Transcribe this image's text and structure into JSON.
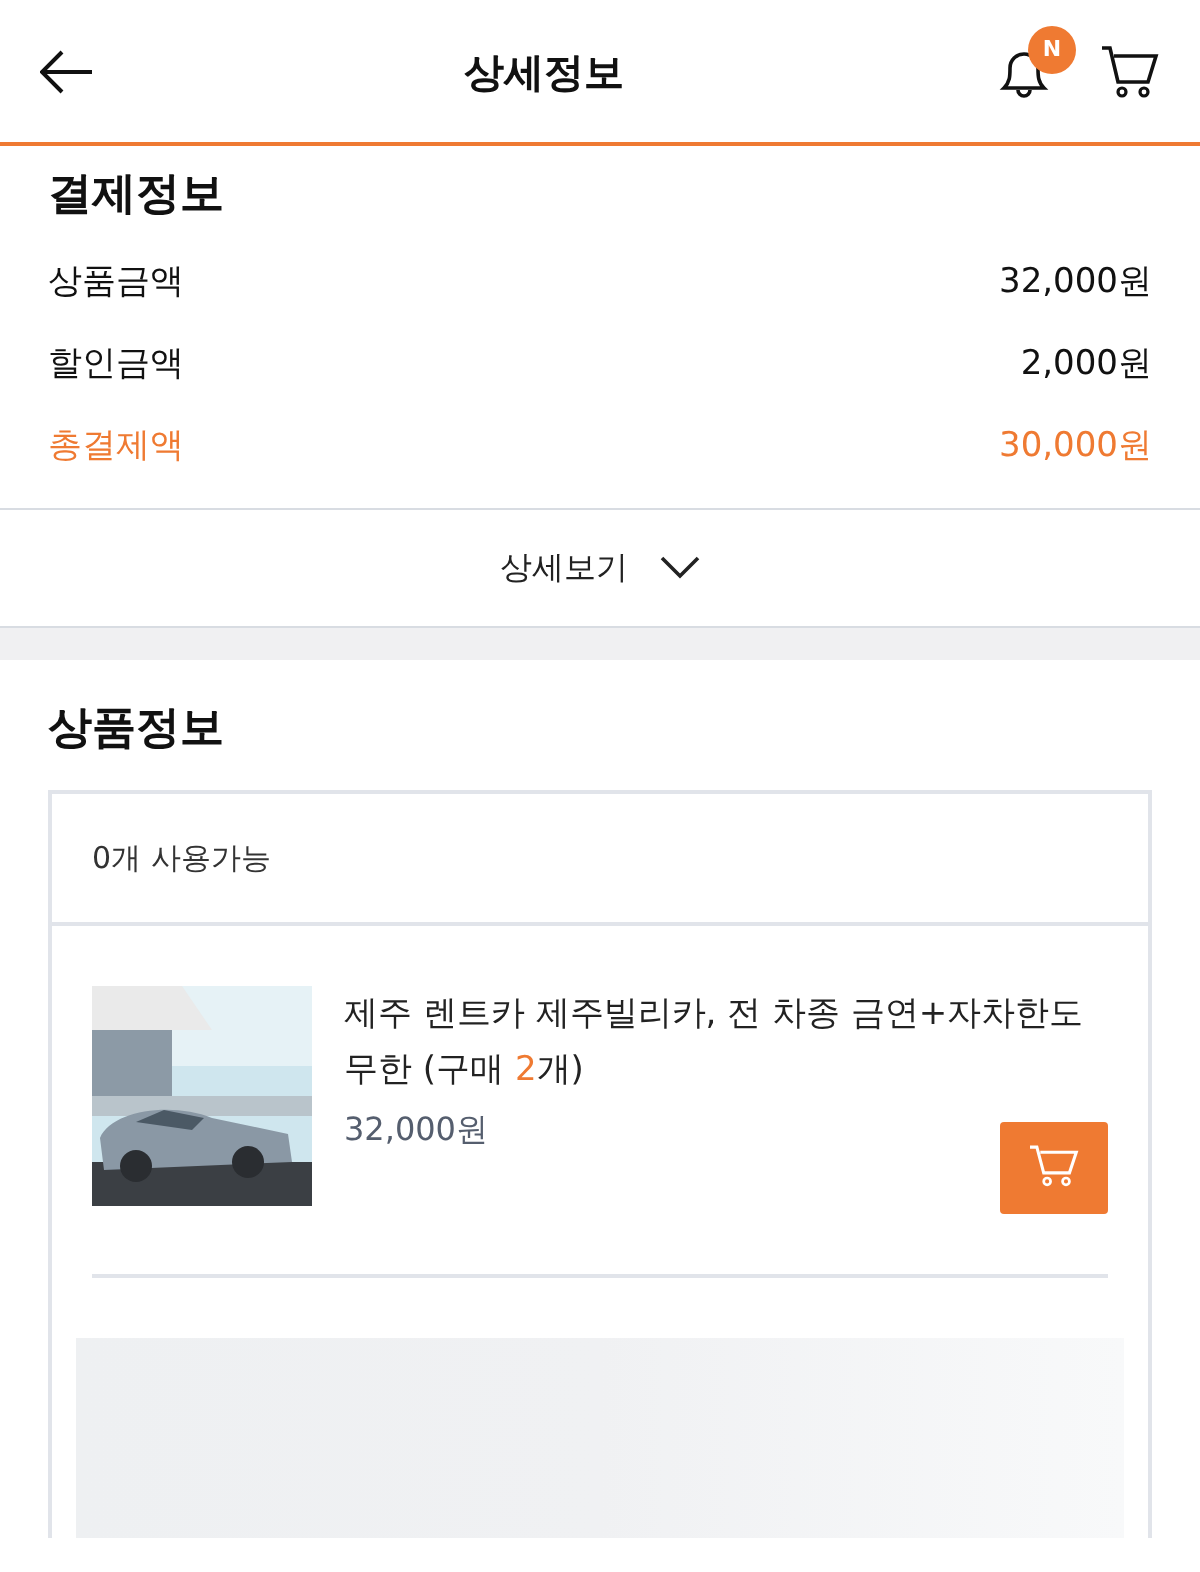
{
  "header": {
    "title": "상세정보",
    "notification_badge": "N"
  },
  "payment": {
    "title": "결제정보",
    "rows": [
      {
        "label": "상품금액",
        "amount": "32,000원",
        "kind": "normal"
      },
      {
        "label": "할인금액",
        "amount": "2,000원",
        "kind": "normal"
      },
      {
        "label": "총결제액",
        "amount": "30,000원",
        "kind": "total"
      }
    ],
    "details_button": "상세보기",
    "expanded": false
  },
  "product_info": {
    "title": "상품정보",
    "availability": "0개 사용가능",
    "item": {
      "kind": "picture",
      "name": "제주 렌트카 제주빌리카, 전 차종 금연+자차한도 무한 (구매 ",
      "quantity": "2",
      "name_suffix": "개)",
      "price": "32,000원"
    }
  }
}
